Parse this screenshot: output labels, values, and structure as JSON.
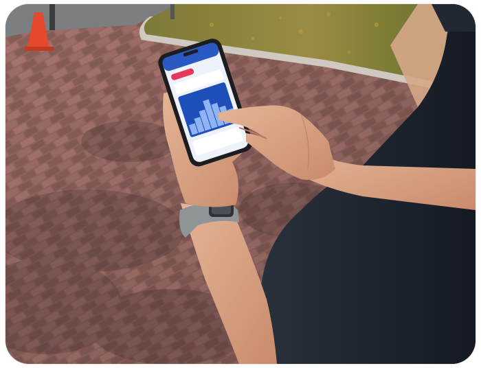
{
  "photo": {
    "scene": "outdoor-brick-walkway",
    "palette": {
      "brick": "#a26c66",
      "brick_dark": "#6f4a46",
      "grass": "#8a8a3a",
      "curb": "#c9c4bb",
      "shirt": "#1f2530",
      "skin": "#d8a585",
      "cone": "#e5482c",
      "screen": "#2b59c3",
      "watch_band": "#8f9597"
    }
  },
  "phone_screen": {
    "status_badge_color": "#e9365a",
    "chart_bars": [
      0.28,
      0.4,
      0.55,
      0.78,
      0.62,
      0.48,
      0.35
    ]
  }
}
